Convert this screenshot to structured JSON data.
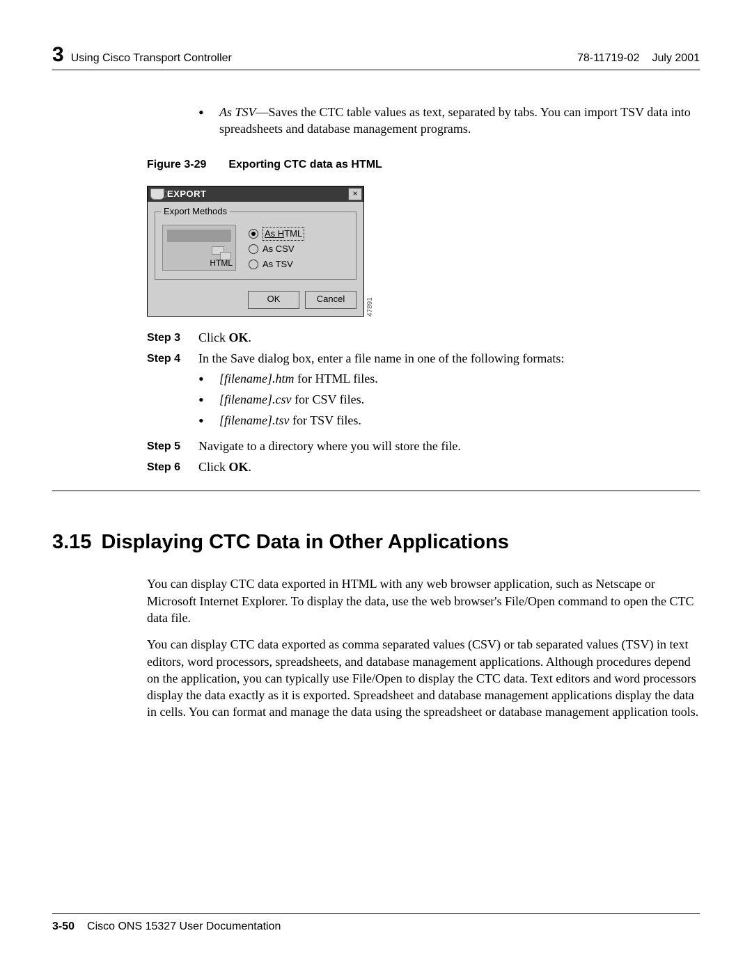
{
  "header": {
    "chapter_number": "3",
    "chapter_title": "Using Cisco Transport Controller",
    "doc_number": "78-11719-02",
    "doc_date": "July 2001"
  },
  "top_bullet": {
    "term": "As TSV",
    "text": "—Saves the CTC table values as text, separated by tabs. You can import TSV data into spreadsheets and database management programs."
  },
  "figure": {
    "label": "Figure 3-29",
    "title": "Exporting CTC data as HTML",
    "id": "47891"
  },
  "dialog": {
    "title": "EXPORT",
    "close": "×",
    "fieldset_label": "Export Methods",
    "preview_label": "HTML",
    "radios": {
      "html_prefix": "As ",
      "html_u": "H",
      "html_rest": "TML",
      "csv": "As CSV",
      "tsv": "As TSV"
    },
    "ok": "OK",
    "cancel": "Cancel"
  },
  "steps": {
    "s3_label": "Step 3",
    "s3_pre": "Click ",
    "s3_bold": "OK",
    "s3_post": ".",
    "s4_label": "Step 4",
    "s4_text": "In the Save dialog box, enter a file name in one of the following formats:",
    "s4_b1_em": "[filename].htm",
    "s4_b1_rest": " for HTML files.",
    "s4_b2_em": "[filename].csv",
    "s4_b2_rest": " for CSV files.",
    "s4_b3_em": "[filename].tsv",
    "s4_b3_rest": " for TSV files.",
    "s5_label": "Step 5",
    "s5_text": "Navigate to a directory where you will store the file.",
    "s6_label": "Step 6",
    "s6_pre": "Click ",
    "s6_bold": "OK",
    "s6_post": "."
  },
  "section": {
    "number": "3.15",
    "title": "Displaying CTC Data in Other Applications"
  },
  "para1": "You can display CTC data exported in HTML with any web browser application, such as Netscape or Microsoft Internet Explorer. To display the data, use the web browser's File/Open command to open the CTC data file.",
  "para2": "You can display CTC data exported as comma separated values (CSV) or tab separated values (TSV) in text editors, word processors, spreadsheets, and database management applications. Although procedures depend on the application, you can typically use File/Open to display the CTC data. Text editors and word processors display the data exactly as it is exported. Spreadsheet and database management applications display the data in cells. You can format and manage the data using the spreadsheet or database management application tools.",
  "footer": {
    "page": "3-50",
    "doc": "Cisco ONS 15327 User Documentation"
  }
}
